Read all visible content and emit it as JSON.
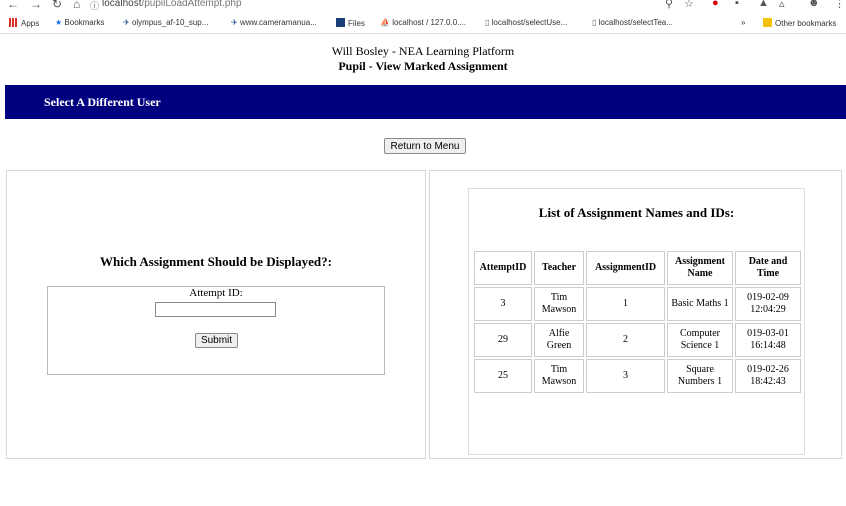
{
  "browser": {
    "url_host": "localhost",
    "url_path": "/pupilLoadAttempt.php",
    "bookmarks": [
      {
        "label": "Apps",
        "icon": "apps-grid-icon",
        "color": "#d93025"
      },
      {
        "label": "Bookmarks",
        "icon": "star-icon",
        "color": "#1a73e8"
      },
      {
        "label": "olympus_af-10_sup...",
        "icon": "site-icon",
        "color": "#1a4d8f"
      },
      {
        "label": "www.cameramanua...",
        "icon": "site-icon",
        "color": "#1a4d8f"
      },
      {
        "label": "Files",
        "icon": "files-icon",
        "color": "#1a3e7a"
      },
      {
        "label": "localhost / 127.0.0....",
        "icon": "phpmyadmin-icon",
        "color": "#f29111"
      },
      {
        "label": "localhost/selectUse...",
        "icon": "page-icon",
        "color": "#666666"
      },
      {
        "label": "localhost/selectTea...",
        "icon": "page-icon",
        "color": "#666666"
      },
      {
        "label": "»",
        "icon": "",
        "color": "#666666"
      },
      {
        "label": "Other bookmarks",
        "icon": "folder-icon",
        "color": "#f4c20d"
      }
    ]
  },
  "header": {
    "site_title": "Will Bosley - NEA Learning Platform",
    "page_title": "Pupil - View Marked Assignment"
  },
  "nav": {
    "link": "Select A Different User",
    "bg_color": "#00007f"
  },
  "return_button": "Return to Menu",
  "form": {
    "heading": "Which Assignment Should be Displayed?:",
    "label": "Attempt ID:",
    "input_value": "",
    "submit": "Submit"
  },
  "list": {
    "heading": "List of Assignment Names and IDs:",
    "columns": [
      "AttemptID",
      "Teacher",
      "AssignmentID",
      "Assignment Name",
      "Date and Time"
    ],
    "rows": [
      [
        "3",
        "Tim Mawson",
        "1",
        "Basic Maths 1",
        "019-02-09 12:04:29"
      ],
      [
        "29",
        "Alfie Green",
        "2",
        "Computer Science 1",
        "019-03-01 16:14:48"
      ],
      [
        "25",
        "Tim Mawson",
        "3",
        "Square Numbers 1",
        "019-02-26 18:42:43"
      ]
    ]
  }
}
